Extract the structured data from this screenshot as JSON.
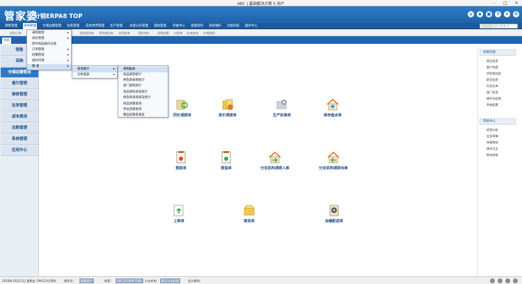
{
  "window": {
    "title": "ABC  |  基础解决方案 5 用户",
    "minimize": "–",
    "maximize": "□",
    "close": "✕"
  },
  "header": {
    "logo": "管家婆",
    "logo_sub": "分销ERPA8 TOP",
    "icons": [
      "home-icon",
      "user-icon",
      "lock-icon",
      "help-icon",
      "close-icon",
      "settings-icon"
    ]
  },
  "menubar": {
    "items": [
      "销售管理",
      "采购管理",
      "仓储运输管理",
      "往来管理",
      "成本费用管理",
      "生产管理",
      "总部分店管理",
      "辅助管理",
      "单据中心",
      "基础资料",
      "系统维护",
      "功能导航",
      "服务中心"
    ],
    "search_placeholder": "功能搜索Ctrl+Shift+F"
  },
  "tabbar": {
    "items": [
      "采购订单",
      "采购单",
      "采购退货单",
      "采购换货单",
      "进货账单",
      "采购询价",
      "采购结算",
      "付款单",
      "采购分析",
      "库存查询",
      "往来查询",
      "价格跟踪"
    ]
  },
  "strip": {
    "tab": "导航"
  },
  "sidebar": {
    "items": [
      "销售",
      "采购",
      "仓储运输管理",
      "催欠管理",
      "维修管理",
      "往来管理",
      "成本费用",
      "总账管理",
      "系统管理",
      "应用中心"
    ]
  },
  "main": {
    "functions": [
      {
        "label": "同价调拨单",
        "icon": "transfer-icon"
      },
      {
        "label": "变价调拨单",
        "icon": "price-transfer-icon"
      },
      {
        "label": "生产拆装单",
        "icon": "assembly-icon"
      },
      {
        "label": "库存盘点单",
        "icon": "inventory-icon"
      },
      {
        "label": "报损单",
        "icon": "loss-report-icon"
      },
      {
        "label": "报溢单",
        "icon": "overflow-report-icon"
      },
      {
        "label": "分支机构调拨入库",
        "icon": "branch-inbound-icon"
      },
      {
        "label": "分支机构调拨出库",
        "icon": "branch-outbound-icon"
      },
      {
        "label": "上架单",
        "icon": "shelving-icon"
      },
      {
        "label": "拣货单",
        "icon": "picking-icon"
      },
      {
        "label": "运输配送单",
        "icon": "delivery-icon"
      }
    ]
  },
  "dropdown": {
    "level1": [
      {
        "label": "采购管理",
        "arrow": true
      },
      {
        "label": "询价管理",
        "arrow": true
      },
      {
        "label": "库存商品报价分类",
        "arrow": false
      },
      {
        "label": "订单管理",
        "arrow": true
      },
      {
        "label": "结算管理",
        "arrow": true
      },
      {
        "label": "委托代销",
        "arrow": true
      },
      {
        "label": "报    表",
        "arrow": true
      }
    ],
    "level2": [
      {
        "label": "查询统计",
        "arrow": true
      },
      {
        "label": "分析报表",
        "arrow": true
      }
    ],
    "level3": [
      {
        "label": "采购报表"
      },
      {
        "label": "商品采购统计"
      },
      {
        "label": "供货商采购统计"
      },
      {
        "label": "部门采购统计"
      },
      {
        "label": "商品采购进货统计"
      },
      {
        "label": "供货商采购退货统计"
      },
      {
        "label": "商品获赠查询"
      },
      {
        "label": "单位获赠查询"
      },
      {
        "label": "赠品获赠来源表"
      }
    ]
  },
  "right_panel": {
    "section1": {
      "title": "关联功能",
      "links": [
        "商品信息",
        "客户档案",
        "供货商档案",
        "职员信息",
        "存货仓库",
        "部门信息",
        "操作员权限",
        "系统配置"
      ]
    },
    "section2": {
      "title": "审核中心",
      "links": [
        "经营分析",
        "业务草稿",
        "单据审核",
        "操作日志",
        "期末结账"
      ]
    }
  },
  "statusbar": {
    "date": "2018年10月12日 星期五 19时22分58秒",
    "operator_label": "操作员：",
    "operator_value": "超级用户",
    "account_label": "帐套：",
    "account_value": "ABC20180911Nb",
    "branch_label": "分支机构：",
    "branch_value": "默认分支机构",
    "period_label": "会计期间："
  },
  "colors": {
    "brand": "#1f63aa",
    "menubar": "#1c5a9c",
    "highlight": "#cfe0f3"
  }
}
